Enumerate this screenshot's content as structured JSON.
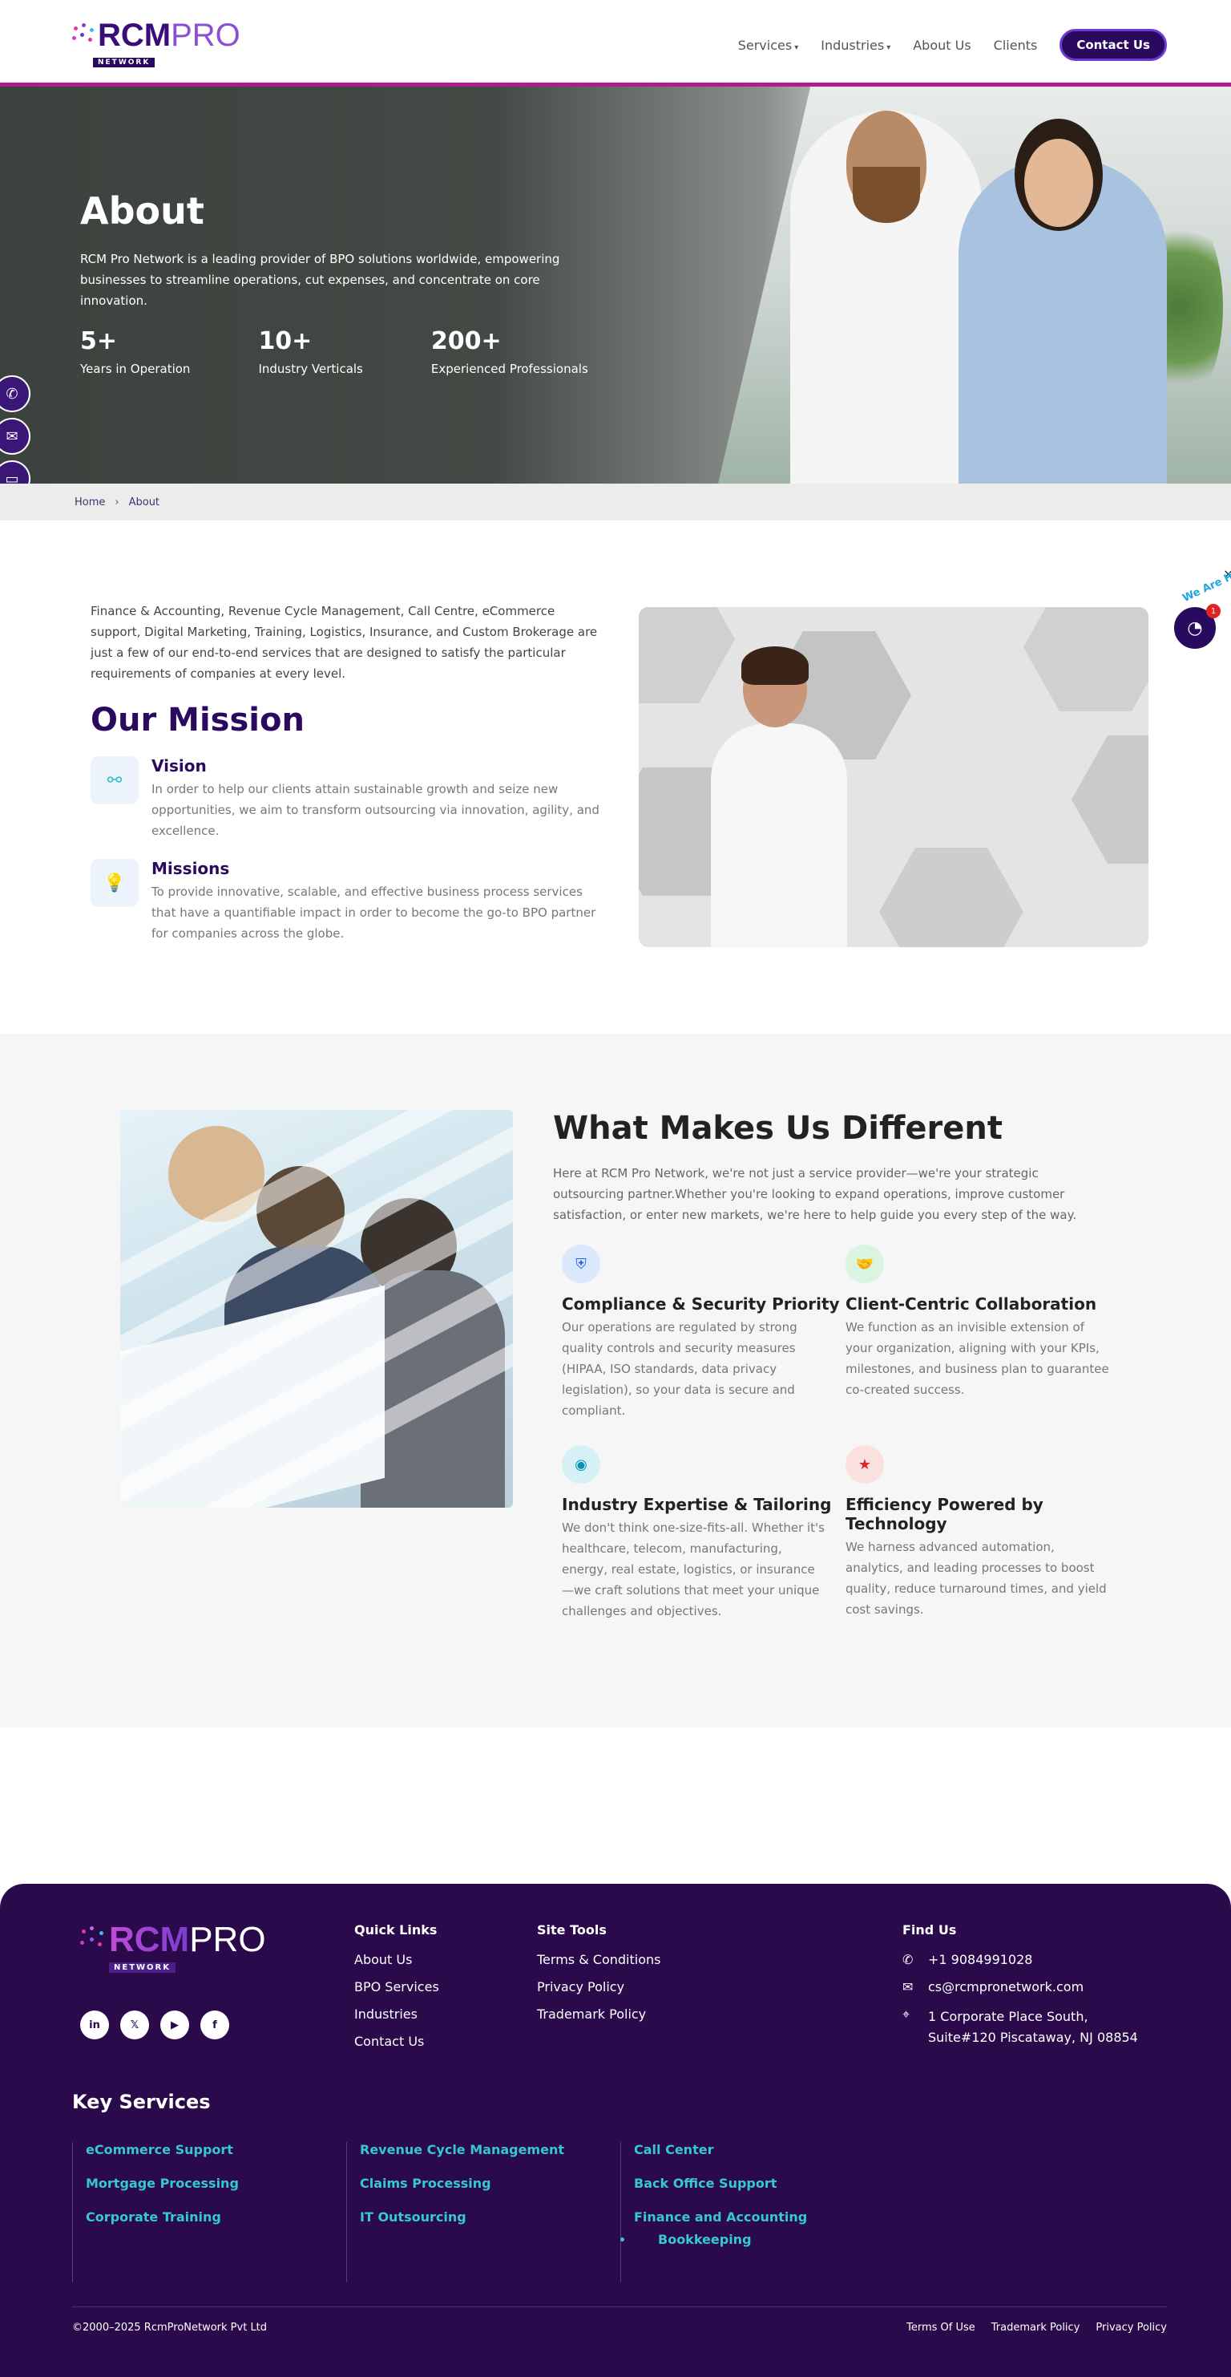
{
  "header": {
    "logo": {
      "rcm": "RCM",
      "pro": "PRO",
      "sub": "NETWORK"
    },
    "nav": [
      {
        "label": "Services",
        "caret": "▾"
      },
      {
        "label": "Industries",
        "caret": "▾"
      },
      {
        "label": "About Us"
      },
      {
        "label": "Clients"
      }
    ],
    "cta": "Contact Us"
  },
  "hero": {
    "title": "About",
    "description": "RCM Pro Network is a leading provider of BPO solutions worldwide, empowering businesses to streamline operations, cut expenses, and concentrate on core innovation.",
    "stats": [
      {
        "value": "5+",
        "label": "Years in Operation"
      },
      {
        "value": "10+",
        "label": "Industry Verticals"
      },
      {
        "value": "200+",
        "label": "Experienced Professionals"
      }
    ]
  },
  "side_icons": [
    "phone-icon",
    "mail-icon",
    "chat-icon"
  ],
  "breadcrumb": {
    "home": "Home",
    "sep": "›",
    "current": "About"
  },
  "mission": {
    "intro": "Finance & Accounting, Revenue Cycle Management, Call Centre, eCommerce support, Digital Marketing, Training, Logistics, Insurance, and Custom Brokerage are just a few of our end-to-end services that are designed to satisfy the particular requirements of companies at every level.",
    "title": "Our Mission",
    "items": [
      {
        "title": "Vision",
        "text": "In order to help our clients attain sustainable growth and seize new opportunities, we aim to transform outsourcing via innovation, agility, and excellence.",
        "icon": "binoculars-icon"
      },
      {
        "title": "Missions",
        "text": "To provide innovative, scalable, and effective business process services that have a quantifiable impact in order to become the go-to BPO partner for companies across the globe.",
        "icon": "lightbulb-icon"
      }
    ]
  },
  "chat": {
    "label": "We Are Here!",
    "badge": "1",
    "close": "×"
  },
  "different": {
    "title": "What Makes Us Different",
    "description": "Here at RCM Pro Network, we're not just a service provider—we're your strategic outsourcing partner.Whether you're looking to expand operations, improve customer satisfaction, or enter new markets, we're here to help guide you every step of the way.",
    "features": [
      {
        "title": "Compliance & Security Priority",
        "text": "Our operations are regulated by strong quality controls and security measures (HIPAA, ISO standards, data privacy legislation), so your data is secure and compliant.",
        "icon": "shield-icon",
        "color": "#2563eb",
        "bg": "#dbe7fb"
      },
      {
        "title": "Client-Centric Collaboration",
        "text": "We function as an invisible extension of your organization, aligning with your KPIs, milestones, and business plan to guarantee co-created success.",
        "icon": "handshake-icon",
        "color": "#16a34a",
        "bg": "#d9f5e1"
      },
      {
        "title": "Industry Expertise & Tailoring",
        "text": "We don't think one-size-fits-all. Whether it's healthcare, telecom, manufacturing, energy, real estate, logistics, or insurance—we craft solutions that meet your unique challenges and objectives.",
        "icon": "eye-icon",
        "color": "#0891b2",
        "bg": "#d6f1f6"
      },
      {
        "title": "Efficiency Powered by Technology",
        "text": "We harness advanced automation, analytics, and leading processes to boost quality, reduce turnaround times, and yield cost savings.",
        "icon": "star-icon",
        "color": "#dc2626",
        "bg": "#fbe0e0"
      }
    ]
  },
  "footer": {
    "logo": {
      "rcm": "RCM",
      "pro": "PRO",
      "sub": "NETWORK"
    },
    "social": [
      "in",
      "𝕏",
      "▶",
      "f"
    ],
    "quick_links": {
      "title": "Quick Links",
      "items": [
        "About Us",
        "BPO Services",
        "Industries",
        "Contact Us"
      ]
    },
    "site_tools": {
      "title": "Site Tools",
      "items": [
        "Terms & Conditions",
        "Privacy Policy",
        "Trademark Policy"
      ]
    },
    "find_us": {
      "title": "Find Us",
      "phone": "+1 9084991028",
      "email": "cs@rcmpronetwork.com",
      "address": "1 Corporate Place South, Suite#120 Piscataway, NJ 08854"
    },
    "key_services": {
      "title": "Key Services",
      "columns": [
        [
          "eCommerce Support",
          "Mortgage Processing",
          "Corporate Training"
        ],
        [
          "Revenue Cycle Management",
          "Claims Processing",
          "IT Outsourcing"
        ],
        [
          "Call Center",
          "Back Office Support",
          "Finance and Accounting"
        ]
      ],
      "sub_item": "Bookkeeping"
    },
    "copyright": "©2000–2025 RcmProNetwork Pvt Ltd",
    "bottom_links": [
      "Terms Of Use",
      "Trademark Policy",
      "Privacy Policy"
    ]
  }
}
